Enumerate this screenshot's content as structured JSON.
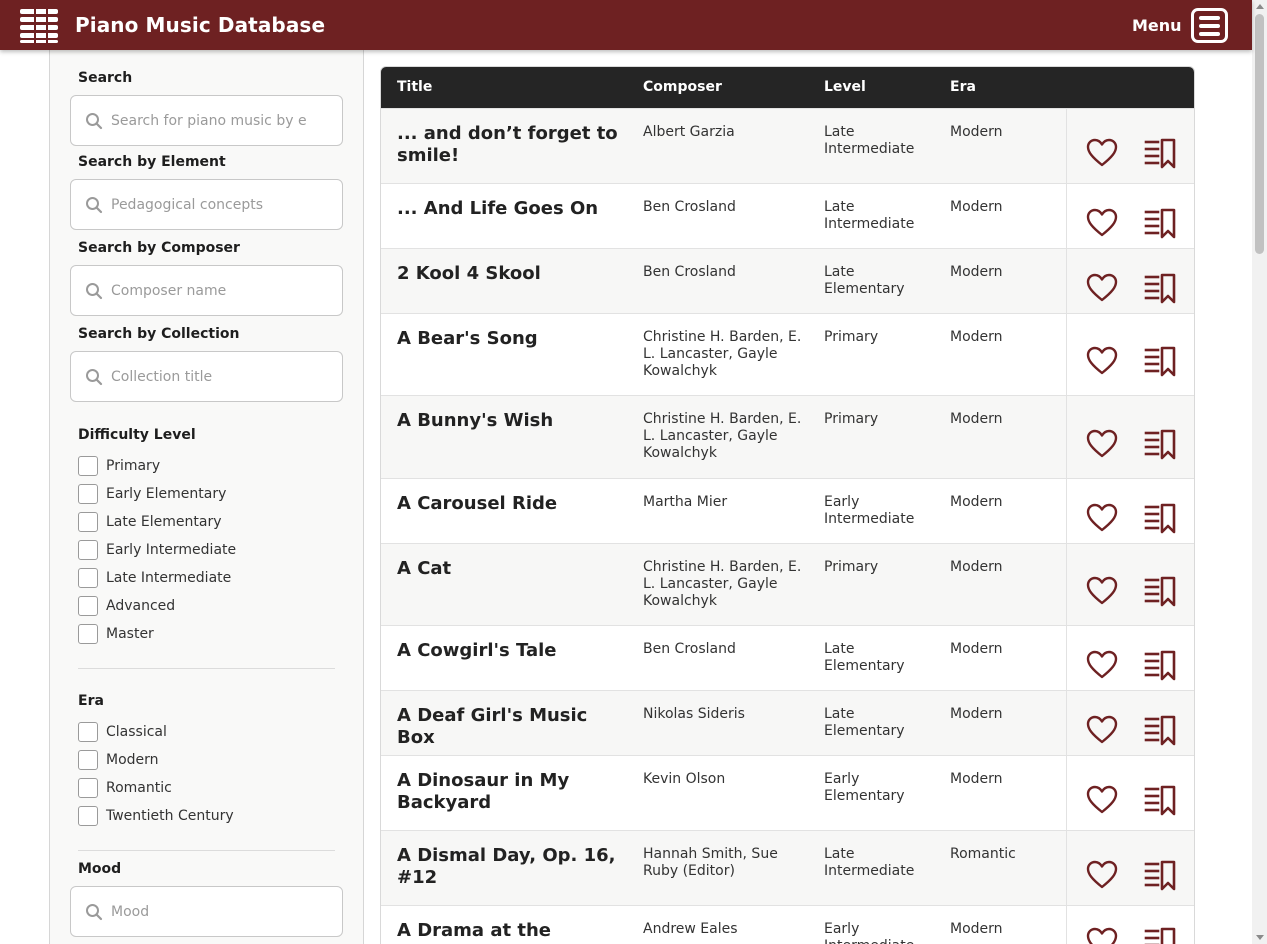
{
  "header": {
    "app_title": "Piano Music Database",
    "menu_label": "Menu"
  },
  "colors": {
    "brand": "#6e2122",
    "table_header": "#252525"
  },
  "sidebar": {
    "search": {
      "label": "Search",
      "placeholder": "Search for piano music by e"
    },
    "search_element": {
      "label": "Search by Element",
      "placeholder": "Pedagogical concepts"
    },
    "search_composer": {
      "label": "Search by Composer",
      "placeholder": "Composer name"
    },
    "search_collection": {
      "label": "Search by Collection",
      "placeholder": "Collection title"
    },
    "difficulty": {
      "label": "Difficulty Level",
      "options": [
        "Primary",
        "Early Elementary",
        "Late Elementary",
        "Early Intermediate",
        "Late Intermediate",
        "Advanced",
        "Master"
      ]
    },
    "era": {
      "label": "Era",
      "options": [
        "Classical",
        "Modern",
        "Romantic",
        "Twentieth Century"
      ]
    },
    "mood": {
      "label": "Mood",
      "placeholder": "Mood"
    }
  },
  "table": {
    "columns": [
      "Title",
      "Composer",
      "Level",
      "Era"
    ],
    "rows": [
      {
        "title": "... and don’t forget to smile!",
        "composer": "Albert Garzia",
        "level": "Late Intermediate",
        "era": "Modern"
      },
      {
        "title": "... And Life Goes On",
        "composer": "Ben Crosland",
        "level": "Late Intermediate",
        "era": "Modern"
      },
      {
        "title": "2 Kool 4 Skool",
        "composer": "Ben Crosland",
        "level": "Late Elementary",
        "era": "Modern"
      },
      {
        "title": "A Bear's Song",
        "composer": "Christine H. Barden, E. L. Lancaster, Gayle Kowalchyk",
        "level": "Primary",
        "era": "Modern"
      },
      {
        "title": "A Bunny's Wish",
        "composer": "Christine H. Barden, E. L. Lancaster, Gayle Kowalchyk",
        "level": "Primary",
        "era": "Modern"
      },
      {
        "title": "A Carousel Ride",
        "composer": "Martha Mier",
        "level": "Early Intermediate",
        "era": "Modern"
      },
      {
        "title": "A Cat",
        "composer": "Christine H. Barden, E. L. Lancaster, Gayle Kowalchyk",
        "level": "Primary",
        "era": "Modern"
      },
      {
        "title": "A Cowgirl's Tale",
        "composer": "Ben Crosland",
        "level": "Late Elementary",
        "era": "Modern"
      },
      {
        "title": "A Deaf Girl's Music Box",
        "composer": "Nikolas Sideris",
        "level": "Late Elementary",
        "era": "Modern"
      },
      {
        "title": "A Dinosaur in My Backyard",
        "composer": "Kevin Olson",
        "level": "Early Elementary",
        "era": "Modern"
      },
      {
        "title": "A Dismal Day, Op. 16, #12",
        "composer": "Hannah Smith, Sue Ruby (Editor)",
        "level": "Late Intermediate",
        "era": "Romantic"
      },
      {
        "title": "A Drama at the Theatre",
        "composer": "Andrew Eales",
        "level": "Early Intermediate",
        "era": "Modern"
      }
    ]
  }
}
